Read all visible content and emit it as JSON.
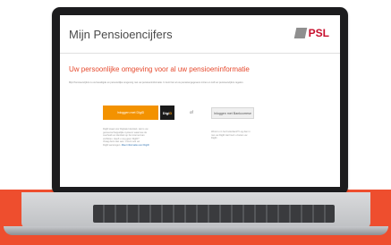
{
  "app": {
    "title": "Mijn Pensioencijfers",
    "logo_text": "PSL"
  },
  "main": {
    "heading": "Uw persoonlijke omgeving voor al uw pensioeninformatie",
    "intro": "Mijn Pensioencijfers is uw beveiligde en persoonlijke omgeving met uw pensioeninformatie. U kunt hier al uw pensioengegevens inzien en zelf uw pensioencijfers regelen.",
    "login_digid_label": "Inloggen met DigiD",
    "digid_logo": {
      "di": "Digi",
      "d": "D"
    },
    "or_label": "of",
    "login_bank_label": "Inloggen met Bankcorrese",
    "left_note_lines": [
      "DigiD staat voor Digitale Identiteit. Het is uw",
      "gemeenschappelijke systeem waarmee de",
      "overheid uw identiteit op het internet kan",
      "verifiëren. Heeft u nog geen DigiD?",
      "Vraag deze dan aan. U kunt ook uw",
      "DigiD aanvragen."
    ],
    "left_note_link": "Meer informatie over DigiD",
    "right_note_lines": [
      "Woont u in het buitenland? Log dan in",
      "met uw DigiD dat hoort u buiten uw",
      "DigiD."
    ]
  },
  "colors": {
    "accent": "#e64a2e",
    "digid_orange": "#f39200",
    "background_band": "#ee4e2e"
  }
}
